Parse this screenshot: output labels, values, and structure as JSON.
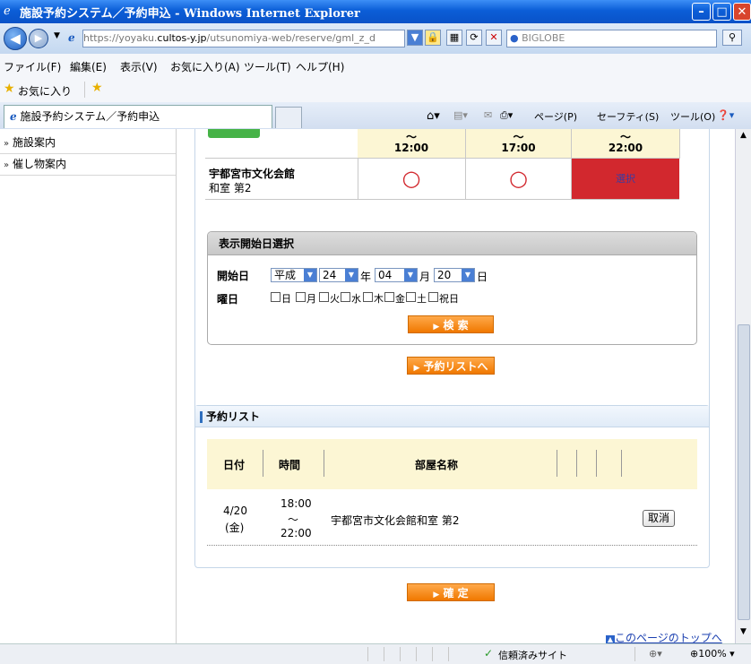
{
  "window": {
    "title": "施設予約システム／予約申込 - Windows Internet Explorer"
  },
  "address": {
    "url_prefix": "https://yoyaku.",
    "url_domain": "cultos-y.jp",
    "url_path": "/utsunomiya-web/reserve/gml_z_d",
    "search_provider": "BIGLOBE"
  },
  "menu": {
    "items": [
      "ファイル(F)",
      "編集(E)",
      "表示(V)",
      "お気に入り(A)",
      "ツール(T)",
      "ヘルプ(H)"
    ]
  },
  "favorites": {
    "label": "お気に入り"
  },
  "tabs": {
    "active_tab": "施設予約システム／予約申込"
  },
  "commandbar": {
    "page": "ページ(P)",
    "safety": "セーフティ(S)",
    "tools": "ツール(O)"
  },
  "sidebar": {
    "items": [
      {
        "label": "施設案内"
      },
      {
        "label": "催し物案内"
      }
    ]
  },
  "availability": {
    "slots": [
      {
        "tilde": "～",
        "end": "12:00"
      },
      {
        "tilde": "～",
        "end": "17:00"
      },
      {
        "tilde": "～",
        "end": "22:00"
      }
    ],
    "facility_name": "宇都宮市文化会館",
    "room_name": "和室 第2",
    "cells": [
      {
        "symbol": "○",
        "state": "available"
      },
      {
        "symbol": "○",
        "state": "available"
      },
      {
        "symbol": "選択",
        "state": "selected"
      }
    ],
    "selected_color": "#d2282e"
  },
  "date_picker": {
    "header": "表示開始日選択",
    "start_label": "開始日",
    "era": "平成",
    "year": "24",
    "year_unit": "年",
    "month": "04",
    "month_unit": "月",
    "day": "20",
    "day_unit": "日",
    "weekday_label": "曜日",
    "weekdays": [
      "日",
      "月",
      "火",
      "水",
      "木",
      "金",
      "土",
      "祝日"
    ],
    "search_button": "検 索"
  },
  "reserve_list_button": "予約リストへ",
  "reservation_list": {
    "header": "予約リスト",
    "columns": {
      "date": "日付",
      "time": "時間",
      "room": "部屋名称"
    },
    "rows": [
      {
        "date": "4/20",
        "weekday": "(金)",
        "start": "18:00",
        "tilde": "～",
        "end": "22:00",
        "room": "宇都宮市文化会館和室 第2",
        "cancel": "取消"
      }
    ]
  },
  "confirm_button": "確 定",
  "page_top_link": "このページのトップへ",
  "status": {
    "trusted": "信頼済みサイト",
    "zoom": "100%"
  }
}
